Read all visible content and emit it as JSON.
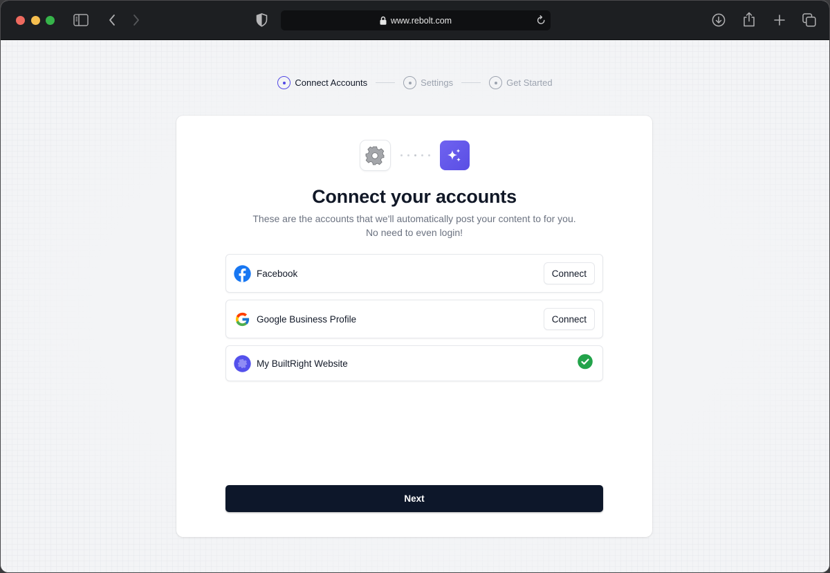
{
  "browser": {
    "url": "www.rebolt.com",
    "icons": {
      "sidebar": "sidebar-icon",
      "back": "chevron-left-icon",
      "forward": "chevron-right-icon",
      "privacy": "shield-icon",
      "lock": "lock-icon",
      "reload": "reload-icon",
      "download": "download-icon",
      "share": "share-icon",
      "new_tab": "plus-icon",
      "tabs": "tabs-overview-icon"
    }
  },
  "stepper": {
    "steps": [
      {
        "label": "Connect Accounts",
        "state": "active"
      },
      {
        "label": "Settings",
        "state": "inactive"
      },
      {
        "label": "Get Started",
        "state": "inactive"
      }
    ],
    "active_color": "#5046e5",
    "inactive_color": "#9ca3af"
  },
  "card": {
    "title": "Connect your accounts",
    "subtitle_line1": "These are the accounts that we'll automatically post your content to for you.",
    "subtitle_line2": "No need to even login!",
    "hero_icons": [
      "gear-icon",
      "sparkles-icon"
    ],
    "accounts": [
      {
        "name": "Facebook",
        "icon": "facebook-icon",
        "status": "not_connected",
        "action_label": "Connect"
      },
      {
        "name": "Google Business Profile",
        "icon": "google-icon",
        "status": "not_connected",
        "action_label": "Connect"
      },
      {
        "name": "My BuiltRight Website",
        "icon": "builtright-gear-icon",
        "status": "connected"
      }
    ],
    "next_label": "Next"
  },
  "colors": {
    "brand": "#5b50e6",
    "primary_button": "#0d172a",
    "success": "#22a34a",
    "facebook": "#1877f2"
  }
}
